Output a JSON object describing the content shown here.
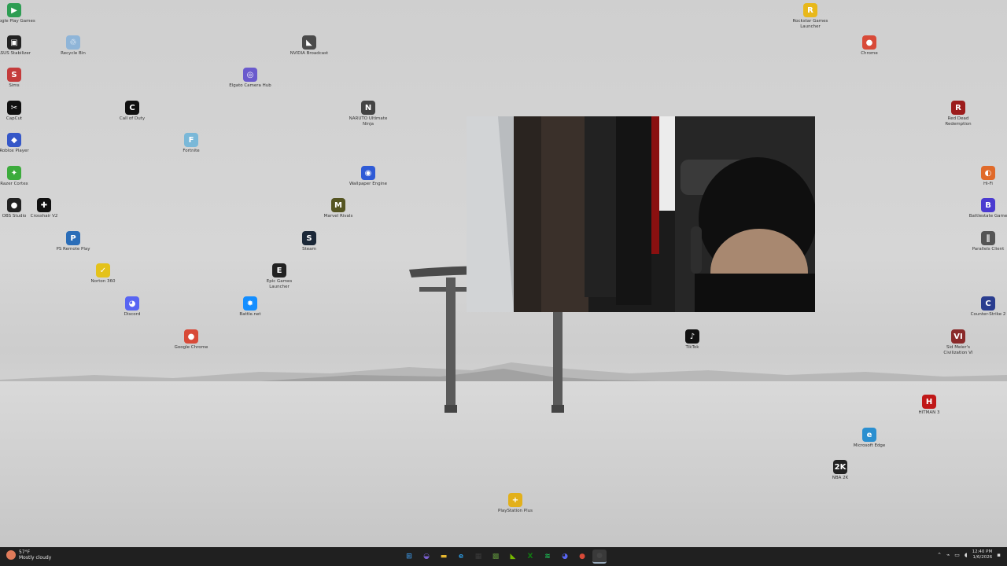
{
  "desktop": {
    "icons": [
      {
        "label": "Google Play Games",
        "icon": "google-play-icon",
        "color": "#2e9d53",
        "glyph": "▶"
      },
      {
        "label": "ASUS Stabilizer",
        "icon": "asus-icon",
        "color": "#222222",
        "glyph": "▣"
      },
      {
        "label": "Recycle Bin",
        "icon": "recycle-bin-icon",
        "color": "#8fb5d8",
        "glyph": "♲"
      },
      {
        "label": "NVIDIA Broadcast",
        "icon": "nvidia-icon",
        "color": "#4a4a4a",
        "glyph": "◣"
      },
      {
        "label": "Rockstar Games Launcher",
        "icon": "rockstar-icon",
        "color": "#e8b81a",
        "glyph": "R"
      },
      {
        "label": "Sims",
        "icon": "sims-icon",
        "color": "#c43b3b",
        "glyph": "S"
      },
      {
        "label": "Elgato Camera Hub",
        "icon": "camera-hub-icon",
        "color": "#6a5acd",
        "glyph": "◎"
      },
      {
        "label": "Chrome",
        "icon": "chrome-icon",
        "color": "#d84a38",
        "glyph": "●"
      },
      {
        "label": "CapCut",
        "icon": "capcut-icon",
        "color": "#111111",
        "glyph": "✂"
      },
      {
        "label": "Call of Duty",
        "icon": "call-of-duty-icon",
        "color": "#111111",
        "glyph": "C"
      },
      {
        "label": "NARUTO Ultimate Ninja",
        "icon": "naruto-icon",
        "color": "#444444",
        "glyph": "N"
      },
      {
        "label": "Red Dead Redemption",
        "icon": "red-dead-icon",
        "color": "#9c1c1c",
        "glyph": "R"
      },
      {
        "label": "Roblox Player",
        "icon": "roblox-icon",
        "color": "#3557c8",
        "glyph": "◆"
      },
      {
        "label": "Fortnite",
        "icon": "fortnite-icon",
        "color": "#7ab8d8",
        "glyph": "F"
      },
      {
        "label": "Razer Cortex",
        "icon": "razer-icon",
        "color": "#3cab3c",
        "glyph": "✦"
      },
      {
        "label": "Wallpaper Engine",
        "icon": "wallpaper-engine-icon",
        "color": "#2f5bd6",
        "glyph": "◉"
      },
      {
        "label": "OBS Studio",
        "icon": "obs-icon",
        "color": "#222222",
        "glyph": "●"
      },
      {
        "label": "Crosshair V2",
        "icon": "crosshair-icon",
        "color": "#111111",
        "glyph": "✚"
      },
      {
        "label": "Marvel Rivals",
        "icon": "marvel-rivals-icon",
        "color": "#555522",
        "glyph": "M"
      },
      {
        "label": "PS Remote Play",
        "icon": "ps-remote-icon",
        "color": "#2a6db8",
        "glyph": "P"
      },
      {
        "label": "Steam",
        "icon": "steam-icon",
        "color": "#1b2838",
        "glyph": "S"
      },
      {
        "label": "Epic Games Launcher",
        "icon": "epic-games-icon",
        "color": "#222222",
        "glyph": "E"
      },
      {
        "label": "Norton 360",
        "icon": "norton-icon",
        "color": "#e4c21a",
        "glyph": "✓"
      },
      {
        "label": "Discord",
        "icon": "discord-icon",
        "color": "#5865f2",
        "glyph": "◕"
      },
      {
        "label": "Battle.net",
        "icon": "battlenet-icon",
        "color": "#148eff",
        "glyph": "✸"
      },
      {
        "label": "Google Chrome",
        "icon": "google-chrome-icon",
        "color": "#d84a38",
        "glyph": "●"
      },
      {
        "label": "TikTok",
        "icon": "tiktok-icon",
        "color": "#111111",
        "glyph": "♪"
      },
      {
        "label": "Sid Meier's Civilization VI",
        "icon": "civilization-icon",
        "color": "#8a2a2a",
        "glyph": "VI"
      },
      {
        "label": "Hi-Fi",
        "icon": "app-icon",
        "color": "#e06a2a",
        "glyph": "◐"
      },
      {
        "label": "Battlestate Game",
        "icon": "battlestate-icon",
        "color": "#4b3bd0",
        "glyph": "B"
      },
      {
        "label": "Parallels Client",
        "icon": "parallels-icon",
        "color": "#555555",
        "glyph": "∥"
      },
      {
        "label": "Counter-Strike 2",
        "icon": "counter-strike-icon",
        "color": "#2a3d8f",
        "glyph": "C"
      },
      {
        "label": "HITMAN 3",
        "icon": "hitman-icon",
        "color": "#c01818",
        "glyph": "H"
      },
      {
        "label": "Microsoft Edge",
        "icon": "edge-icon",
        "color": "#2a8fd0",
        "glyph": "e"
      },
      {
        "label": "NBA 2K",
        "icon": "nba-icon",
        "color": "#222222",
        "glyph": "2K"
      },
      {
        "label": "PlayStation Plus",
        "icon": "playstation-plus-icon",
        "color": "#e2b01a",
        "glyph": "+"
      }
    ]
  },
  "taskbar": {
    "weather_temp": "57°F",
    "weather_desc": "Mostly cloudy",
    "apps": [
      {
        "name": "start-button",
        "icon": "windows-icon",
        "color": "#3a8fd8",
        "glyph": "⊞"
      },
      {
        "name": "taskbar-copilot",
        "icon": "copilot-icon",
        "color": "#7a5fd0",
        "glyph": "◒"
      },
      {
        "name": "taskbar-explorer",
        "icon": "folder-icon",
        "color": "#e8b830",
        "glyph": "▬"
      },
      {
        "name": "taskbar-edge",
        "icon": "edge-icon",
        "color": "#2a8fd0",
        "glyph": "e"
      },
      {
        "name": "taskbar-store",
        "icon": "store-icon",
        "color": "#3a3a3a",
        "glyph": "▦"
      },
      {
        "name": "taskbar-minecraft",
        "icon": "minecraft-icon",
        "color": "#5a8a3a",
        "glyph": "▩"
      },
      {
        "name": "taskbar-nvidia",
        "icon": "nvidia-icon",
        "color": "#76b900",
        "glyph": "◣"
      },
      {
        "name": "taskbar-xbox",
        "icon": "xbox-icon",
        "color": "#107c10",
        "glyph": "X"
      },
      {
        "name": "taskbar-spotify",
        "icon": "spotify-icon",
        "color": "#1db954",
        "glyph": "≋"
      },
      {
        "name": "taskbar-discord",
        "icon": "discord-icon",
        "color": "#5865f2",
        "glyph": "◕"
      },
      {
        "name": "taskbar-chrome",
        "icon": "chrome-icon",
        "color": "#d84a38",
        "glyph": "●"
      },
      {
        "name": "taskbar-obs",
        "icon": "obs-icon",
        "color": "#444444",
        "glyph": "●"
      }
    ],
    "time": "12:40 PM",
    "date": "1/6/2026"
  }
}
